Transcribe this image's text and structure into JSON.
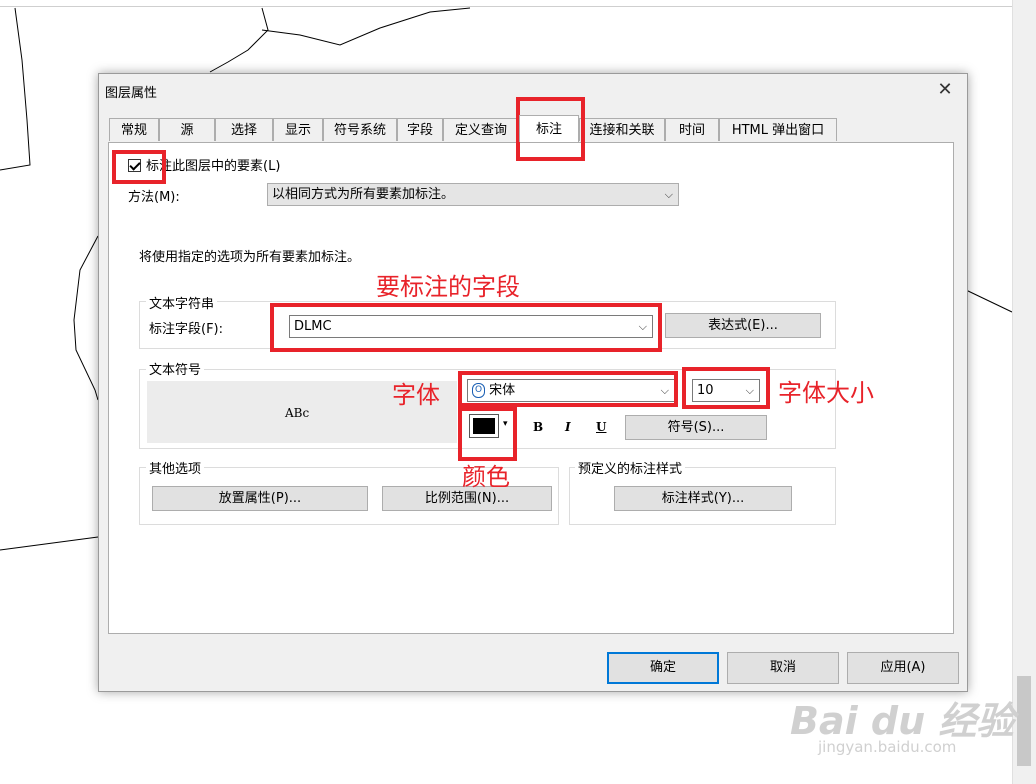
{
  "dialog": {
    "title": "图层属性",
    "close_symbol": "✕",
    "tabs": [
      "常规",
      "源",
      "选择",
      "显示",
      "符号系统",
      "字段",
      "定义查询",
      "标注",
      "连接和关联",
      "时间",
      "HTML 弹出窗口"
    ],
    "active_tab": "标注",
    "label_checkbox": {
      "label": "标注此图层中的要素(L)",
      "checked": true
    },
    "method": {
      "label": "方法(M):",
      "value": "以相同方式为所有要素加标注。"
    },
    "info_text": "将使用指定的选项为所有要素加标注。",
    "text_string": {
      "group_label": "文本字符串",
      "field_label": "标注字段(F):",
      "field_value": "DLMC",
      "expression_button": "表达式(E)..."
    },
    "text_symbol": {
      "group_label": "文本符号",
      "preview_text": "ABc",
      "font_value": "宋体",
      "font_icon": "opentype-font-icon",
      "size_value": "10",
      "color": "#000000",
      "bold_label": "B",
      "italic_label": "I",
      "underline_label": "U",
      "symbol_button": "符号(S)..."
    },
    "other_options": {
      "group_label": "其他选项",
      "placement_button": "放置属性(P)...",
      "scale_button": "比例范围(N)..."
    },
    "predefined": {
      "group_label": "预定义的标注样式",
      "style_button": "标注样式(Y)..."
    },
    "footer": {
      "ok": "确定",
      "cancel": "取消",
      "apply": "应用(A)"
    }
  },
  "annotations": {
    "field": "要标注的字段",
    "font": "字体",
    "size": "字体大小",
    "color": "颜色",
    "highlight_color": "#e8232a"
  },
  "watermark": {
    "brand": "Bai du 经验",
    "url": "jingyan.baidu.com"
  }
}
